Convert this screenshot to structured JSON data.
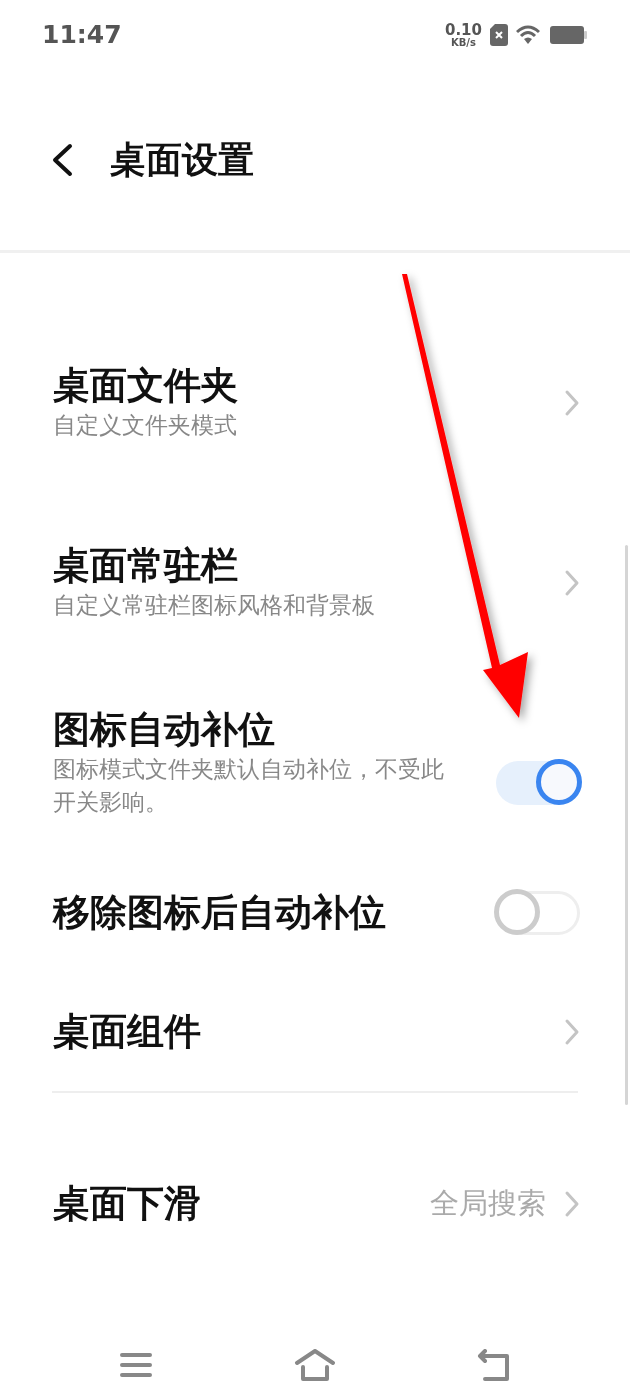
{
  "status_bar": {
    "time": "11:47",
    "net_speed_value": "0.10",
    "net_speed_unit": "KB/s"
  },
  "header": {
    "title": "桌面设置"
  },
  "groups": [
    {
      "items": [
        {
          "kind": "link",
          "title": "桌面文件夹",
          "subtitle": "自定义文件夹模式"
        },
        {
          "kind": "link",
          "title": "桌面常驻栏",
          "subtitle": "自定义常驻栏图标风格和背景板"
        },
        {
          "kind": "toggle",
          "title": "图标自动补位",
          "subtitle": "图标模式文件夹默认自动补位，不受此开关影响。",
          "on": true
        },
        {
          "kind": "toggle",
          "title": "移除图标后自动补位",
          "on": false
        },
        {
          "kind": "link",
          "title": "桌面组件"
        }
      ]
    },
    {
      "items": [
        {
          "kind": "value",
          "title": "桌面下滑",
          "value": "全局搜索"
        }
      ]
    }
  ]
}
